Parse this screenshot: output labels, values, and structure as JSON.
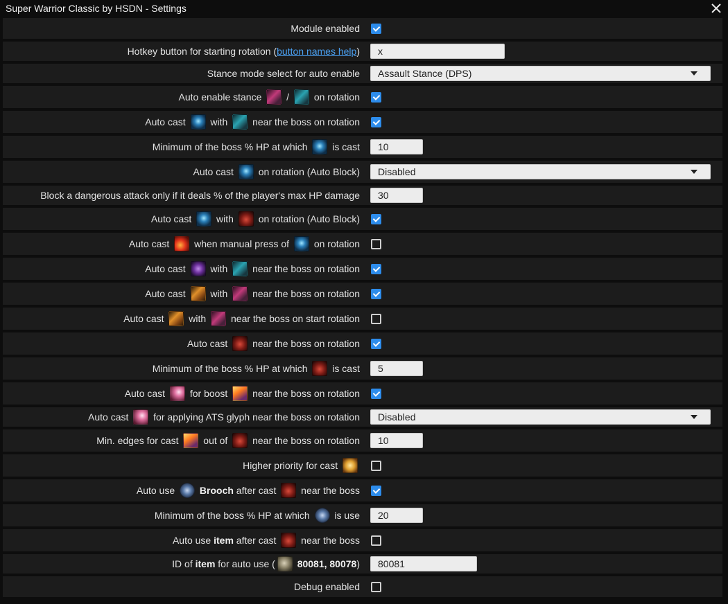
{
  "window": {
    "title": "Super Warrior Classic by HSDN - Settings",
    "close_glyph": "✕"
  },
  "settings": [
    {
      "label": [
        {
          "t": "Module enabled"
        }
      ],
      "control": {
        "type": "checkbox",
        "checked": true
      }
    },
    {
      "label": [
        {
          "t": "Hotkey button for starting rotation ("
        },
        {
          "t": "button names help",
          "link": true
        },
        {
          "t": ")"
        }
      ],
      "control": {
        "type": "text",
        "value": "x"
      }
    },
    {
      "label": [
        {
          "t": "Stance mode select for auto enable"
        }
      ],
      "control": {
        "type": "select",
        "value": "Assault Stance (DPS)"
      }
    },
    {
      "label": [
        {
          "t": "Auto enable stance "
        },
        {
          "icon": "assault-stance-icon"
        },
        {
          "t": " / "
        },
        {
          "icon": "defensive-stance-icon"
        },
        {
          "t": " on rotation"
        }
      ],
      "control": {
        "type": "checkbox",
        "checked": true
      }
    },
    {
      "label": [
        {
          "t": "Auto cast "
        },
        {
          "icon": "deadly-gamble-icon"
        },
        {
          "t": " with "
        },
        {
          "icon": "defensive-stance-icon"
        },
        {
          "t": " near the boss on rotation"
        }
      ],
      "control": {
        "type": "checkbox",
        "checked": true
      }
    },
    {
      "label": [
        {
          "t": "Minimum of the boss % HP at which "
        },
        {
          "icon": "deadly-gamble-icon"
        },
        {
          "t": " is cast"
        }
      ],
      "control": {
        "type": "text",
        "value": "10"
      }
    },
    {
      "label": [
        {
          "t": "Auto cast "
        },
        {
          "icon": "block-icon"
        },
        {
          "t": " on rotation (Auto Block)"
        }
      ],
      "control": {
        "type": "select",
        "value": "Disabled"
      }
    },
    {
      "label": [
        {
          "t": "Block a dangerous attack only if it deals % of the player's max HP damage"
        }
      ],
      "control": {
        "type": "text",
        "value": "30"
      }
    },
    {
      "label": [
        {
          "t": "Auto cast "
        },
        {
          "icon": "block-icon"
        },
        {
          "t": " with "
        },
        {
          "icon": "blade-draw-icon"
        },
        {
          "t": " on rotation (Auto Block)"
        }
      ],
      "control": {
        "type": "checkbox",
        "checked": true
      }
    },
    {
      "label": [
        {
          "t": "Auto cast "
        },
        {
          "icon": "fire-slash-icon"
        },
        {
          "t": " when manual press of "
        },
        {
          "icon": "block-icon"
        },
        {
          "t": " on rotation"
        }
      ],
      "control": {
        "type": "checkbox",
        "checked": false
      }
    },
    {
      "label": [
        {
          "t": "Auto cast "
        },
        {
          "icon": "purple-aura-icon"
        },
        {
          "t": " with "
        },
        {
          "icon": "defensive-stance-icon"
        },
        {
          "t": " near the boss on rotation"
        }
      ],
      "control": {
        "type": "checkbox",
        "checked": true
      }
    },
    {
      "label": [
        {
          "t": "Auto cast "
        },
        {
          "icon": "orange-blade-icon"
        },
        {
          "t": " with "
        },
        {
          "icon": "assault-stance-icon"
        },
        {
          "t": " near the boss on rotation"
        }
      ],
      "control": {
        "type": "checkbox",
        "checked": true
      }
    },
    {
      "label": [
        {
          "t": "Auto cast "
        },
        {
          "icon": "orange-blade-icon"
        },
        {
          "t": " with "
        },
        {
          "icon": "assault-stance-icon"
        },
        {
          "t": " near the boss on start rotation"
        }
      ],
      "control": {
        "type": "checkbox",
        "checked": false
      }
    },
    {
      "label": [
        {
          "t": "Auto cast "
        },
        {
          "icon": "blade-draw-icon"
        },
        {
          "t": " near the boss on rotation"
        }
      ],
      "control": {
        "type": "checkbox",
        "checked": true
      }
    },
    {
      "label": [
        {
          "t": "Minimum of the boss % HP at which "
        },
        {
          "icon": "blade-draw-icon"
        },
        {
          "t": " is cast"
        }
      ],
      "control": {
        "type": "text",
        "value": "5"
      }
    },
    {
      "label": [
        {
          "t": "Auto cast "
        },
        {
          "icon": "beam-icon"
        },
        {
          "t": " for boost "
        },
        {
          "icon": "flare-icon"
        },
        {
          "t": " near the boss on rotation"
        }
      ],
      "control": {
        "type": "checkbox",
        "checked": true
      }
    },
    {
      "label": [
        {
          "t": "Auto cast "
        },
        {
          "icon": "beam-icon"
        },
        {
          "t": " for applying ATS glyph near the boss on rotation"
        }
      ],
      "control": {
        "type": "select",
        "value": "Disabled"
      }
    },
    {
      "label": [
        {
          "t": "Min. edges for cast "
        },
        {
          "icon": "flare-icon"
        },
        {
          "t": " out of "
        },
        {
          "icon": "blade-draw-icon"
        },
        {
          "t": " near the boss on rotation"
        }
      ],
      "control": {
        "type": "text",
        "value": "10"
      }
    },
    {
      "label": [
        {
          "t": "Higher priority for cast "
        },
        {
          "icon": "star-burst-icon"
        }
      ],
      "control": {
        "type": "checkbox",
        "checked": false
      }
    },
    {
      "label": [
        {
          "t": "Auto use "
        },
        {
          "icon": "brooch-icon"
        },
        {
          "t": " "
        },
        {
          "t": "Brooch",
          "bold": true
        },
        {
          "t": " after cast "
        },
        {
          "icon": "blade-draw-icon"
        },
        {
          "t": " near the boss"
        }
      ],
      "control": {
        "type": "checkbox",
        "checked": true
      }
    },
    {
      "label": [
        {
          "t": "Minimum of the boss % HP at which "
        },
        {
          "icon": "brooch-icon"
        },
        {
          "t": " is use"
        }
      ],
      "control": {
        "type": "text",
        "value": "20"
      }
    },
    {
      "label": [
        {
          "t": "Auto use "
        },
        {
          "t": "item",
          "bold": true
        },
        {
          "t": " after cast "
        },
        {
          "icon": "blade-draw-icon"
        },
        {
          "t": " near the boss"
        }
      ],
      "control": {
        "type": "checkbox",
        "checked": false
      }
    },
    {
      "label": [
        {
          "t": "ID of "
        },
        {
          "t": "item",
          "bold": true
        },
        {
          "t": " for auto use ("
        },
        {
          "icon": "item-icon"
        },
        {
          "t": " "
        },
        {
          "t": "80081, 80078",
          "bold": true
        },
        {
          "t": ")"
        }
      ],
      "control": {
        "type": "text",
        "value": "80081",
        "wide": true
      }
    },
    {
      "label": [
        {
          "t": "Debug enabled"
        }
      ],
      "control": {
        "type": "checkbox",
        "checked": false
      }
    }
  ],
  "icon_styles": {
    "assault-stance-icon": "i-pink",
    "defensive-stance-icon": "i-teal",
    "deadly-gamble-icon": "i-cyan-glow",
    "block-icon": "i-cyan-glow",
    "blade-draw-icon": "i-red",
    "fire-slash-icon": "i-fire",
    "purple-aura-icon": "i-purple",
    "orange-blade-icon": "i-orange",
    "beam-icon": "i-beam",
    "flare-icon": "i-flare",
    "star-burst-icon": "i-star",
    "brooch-icon": "i-brooch",
    "item-icon": "i-item"
  },
  "colors": {
    "background": "#0d0d0d",
    "row": "#1c1c1c",
    "checkbox_on": "#2d8ceb",
    "link": "#4a9ff0"
  }
}
